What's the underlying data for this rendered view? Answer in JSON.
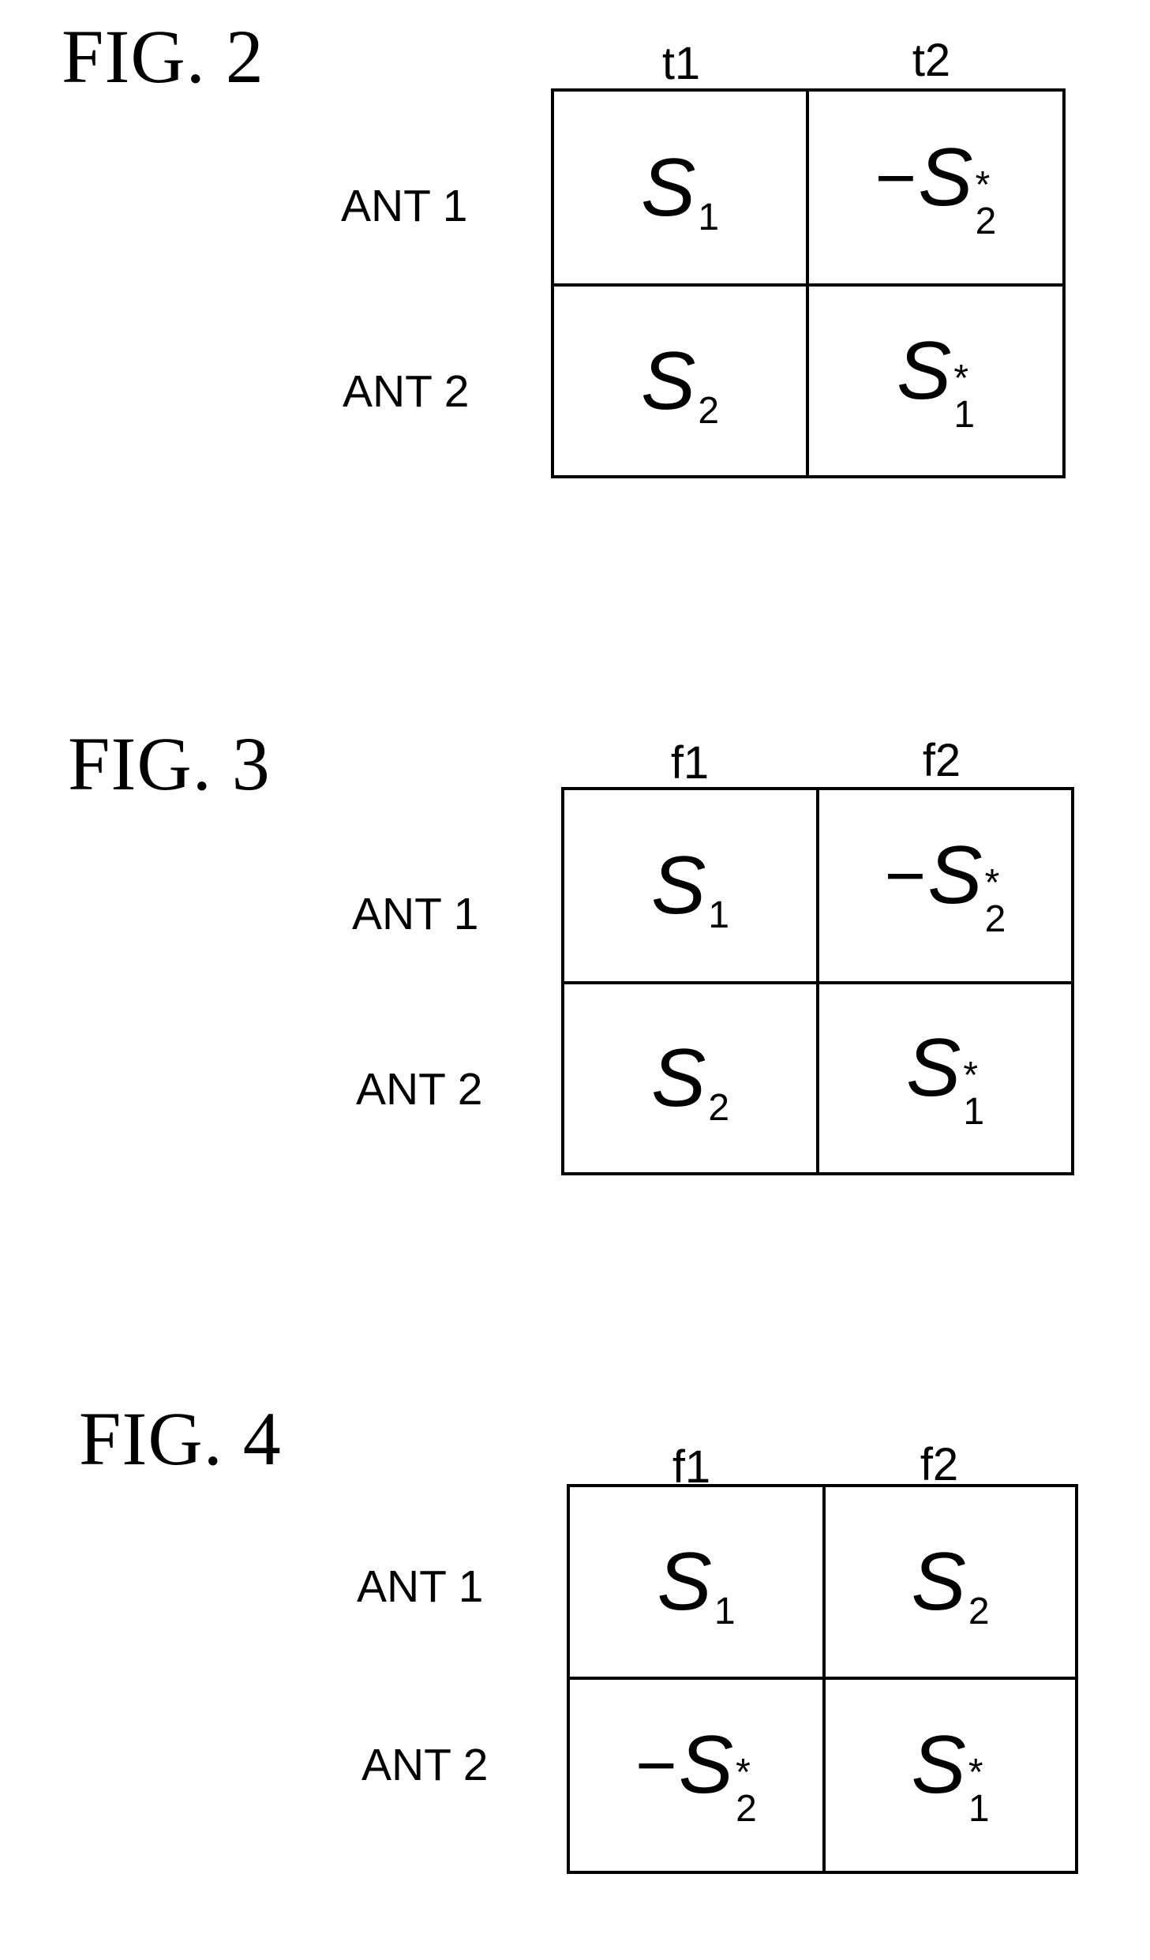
{
  "figures": [
    {
      "title": "FIG. 2",
      "columns": [
        "t1",
        "t2"
      ],
      "rows": [
        {
          "label": "ANT 1",
          "cells": [
            {
              "sign": "",
              "base": "S",
              "sub": "1",
              "sup": ""
            },
            {
              "sign": "−",
              "base": "S",
              "sub": "2",
              "sup": "*"
            }
          ]
        },
        {
          "label": "ANT 2",
          "cells": [
            {
              "sign": "",
              "base": "S",
              "sub": "2",
              "sup": ""
            },
            {
              "sign": "",
              "base": "S",
              "sub": "1",
              "sup": "*"
            }
          ]
        }
      ]
    },
    {
      "title": "FIG. 3",
      "columns": [
        "f1",
        "f2"
      ],
      "rows": [
        {
          "label": "ANT 1",
          "cells": [
            {
              "sign": "",
              "base": "S",
              "sub": "1",
              "sup": ""
            },
            {
              "sign": "−",
              "base": "S",
              "sub": "2",
              "sup": "*"
            }
          ]
        },
        {
          "label": "ANT 2",
          "cells": [
            {
              "sign": "",
              "base": "S",
              "sub": "2",
              "sup": ""
            },
            {
              "sign": "",
              "base": "S",
              "sub": "1",
              "sup": "*"
            }
          ]
        }
      ]
    },
    {
      "title": "FIG. 4",
      "columns": [
        "f1",
        "f2"
      ],
      "rows": [
        {
          "label": "ANT 1",
          "cells": [
            {
              "sign": "",
              "base": "S",
              "sub": "1",
              "sup": ""
            },
            {
              "sign": "",
              "base": "S",
              "sub": "2",
              "sup": ""
            }
          ]
        },
        {
          "label": "ANT 2",
          "cells": [
            {
              "sign": "−",
              "base": "S",
              "sub": "2",
              "sup": "*"
            },
            {
              "sign": "",
              "base": "S",
              "sub": "1",
              "sup": "*"
            }
          ]
        }
      ]
    }
  ]
}
